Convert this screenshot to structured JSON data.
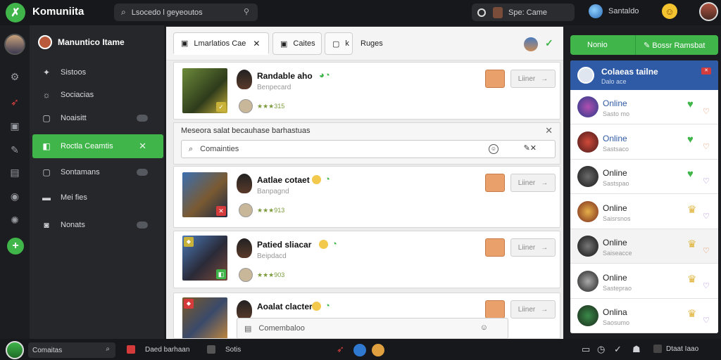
{
  "topbar": {
    "brand": "Komuniita",
    "search_placeholder": "Lsocedo l geyeoutos",
    "game_label": "Spe: Came",
    "status_label": "Santaldo"
  },
  "rail": {
    "icons": [
      "settings-icon",
      "target-icon",
      "note-icon",
      "wrench-icon",
      "archive-icon",
      "badge-icon",
      "gear-icon"
    ]
  },
  "sidebar": {
    "user_name": "Manuntico Itame",
    "items": [
      {
        "label": "Sistoos",
        "icon": "star-icon"
      },
      {
        "label": "Sociacias",
        "icon": "people-icon"
      },
      {
        "label": "Noaisitt",
        "icon": "page-icon"
      },
      {
        "label": "Roctla Ceamtis",
        "icon": "chat-icon"
      },
      {
        "label": "Sontamans",
        "icon": "box-icon"
      },
      {
        "label": "Mei fies",
        "icon": "grid-icon"
      },
      {
        "label": "Nonats",
        "icon": "camera-icon"
      }
    ]
  },
  "main": {
    "tabs": [
      {
        "label": "Lmarlatios Cae"
      },
      {
        "label": "Caites"
      },
      {
        "label": "k"
      }
    ],
    "tab_plain": "Ruges",
    "cards": [
      {
        "name": "Randable aho",
        "sub": "Benpecard",
        "meta": "★★★315"
      },
      {
        "name": "Aatlae cotaet",
        "sub": "Banpagnd",
        "meta": "★★★913"
      },
      {
        "name": "Patied sliacar",
        "sub": "Beipdacd",
        "meta": "★★★903"
      },
      {
        "name": "Aoalat clacter",
        "sub": "",
        "meta": ""
      }
    ],
    "card_button": "Liiner",
    "filter": {
      "title": "Meseora salat becauhase barhastuas",
      "search_value": "Comainties"
    },
    "bottom_input": "Comembaloo"
  },
  "right": {
    "header_left": "Nonio",
    "header_right": "Bossr Ramsbat",
    "panel_title": "Colaeas tailne",
    "panel_sub": "Dalo ace",
    "friends": [
      {
        "status": "Online",
        "sub": "Sasto mo",
        "status_color": "#2f5aa5"
      },
      {
        "status": "Online",
        "sub": "Sastsaco",
        "status_color": "#2f5aa5"
      },
      {
        "status": "Online",
        "sub": "Sastspao",
        "status_color": "#111111"
      },
      {
        "status": "Online",
        "sub": "Saisrsnos",
        "status_color": "#111111"
      },
      {
        "status": "Online",
        "sub": "Saiseacce",
        "status_color": "#111111"
      },
      {
        "status": "Online",
        "sub": "Sasteprao",
        "status_color": "#111111"
      },
      {
        "status": "Onlina",
        "sub": "Saosumo",
        "status_color": "#111111"
      }
    ]
  },
  "bottombar": {
    "search_label": "Comaitas",
    "item1": "Daed barhaan",
    "item2": "Sotis",
    "right_label": "Dtaat Iaao"
  },
  "colors": {
    "accent": "#3fb54a",
    "blue": "#2f5aa5",
    "dark": "#1c1d20"
  }
}
